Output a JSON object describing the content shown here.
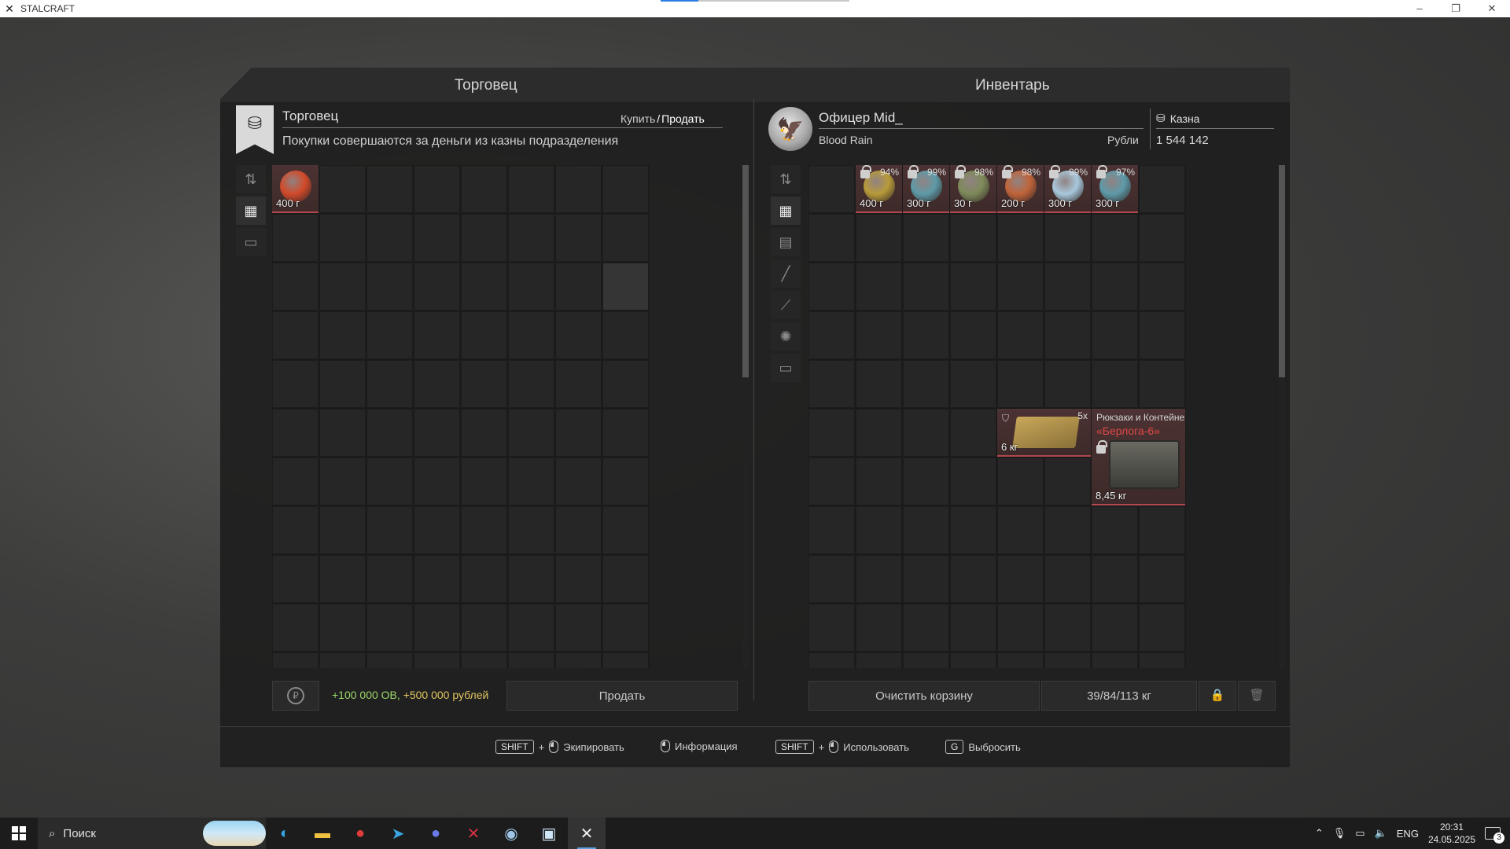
{
  "window": {
    "title": "STALCRAFT",
    "controls": [
      "–",
      "❐",
      "✕"
    ]
  },
  "merchant": {
    "section_title": "Торговец",
    "name": "Торговец",
    "mode_buy": "Купить",
    "mode_separator": "/",
    "mode_sell": "Продать",
    "description": "Покупки совершаются за деньги из казны подразделения",
    "items": [
      {
        "weight": "400 г",
        "color": "#d24a2a"
      }
    ],
    "reward_blue": "+100 000 ОВ,",
    "reward_money": " +500 000 рублей",
    "sell_button": "Продать"
  },
  "inventory": {
    "section_title": "Инвентарь",
    "player_name": "Офицер Mid_",
    "group": "Blood Rain",
    "currency_label": "Рубли",
    "treasury_label": "Казна",
    "treasury_value": "1 544 142",
    "items": [
      {
        "weight": "400 г",
        "percent": "94%",
        "color": "#b89a3a"
      },
      {
        "weight": "300 г",
        "percent": "99%",
        "color": "#5e9aa8"
      },
      {
        "weight": "30 г",
        "percent": "98%",
        "color": "#7e8a5a"
      },
      {
        "weight": "200 г",
        "percent": "98%",
        "color": "#c0643a"
      },
      {
        "weight": "300 г",
        "percent": "99%",
        "color": "#a8c8dc"
      },
      {
        "weight": "300 г",
        "percent": "97%",
        "color": "#5e9aa8"
      }
    ],
    "ammo_box": {
      "count": "5x",
      "weight": "6 кг"
    },
    "container": {
      "category": "Рюкзаки и Контейнеры",
      "name": "«Берлога-6»",
      "weight": "8,45 кг"
    },
    "clear_cart_button": "Очистить корзину",
    "weight_readout": "39/84/113 кг"
  },
  "hotkeys": [
    {
      "key": "SHIFT",
      "plus": "+",
      "label": "Экипировать"
    },
    {
      "label": "Информация"
    },
    {
      "key": "SHIFT",
      "plus": "+",
      "label": "Использовать"
    },
    {
      "key": "G",
      "label": "Выбросить"
    }
  ],
  "taskbar": {
    "search_placeholder": "Поиск",
    "language": "ENG",
    "time": "20:31",
    "date": "24.05.2025",
    "notifications": "3"
  },
  "colors": {
    "accent_red": "#b0484e",
    "reward_green": "#9bd66a",
    "reward_gold": "#e0c460",
    "container_name": "#e04848"
  }
}
